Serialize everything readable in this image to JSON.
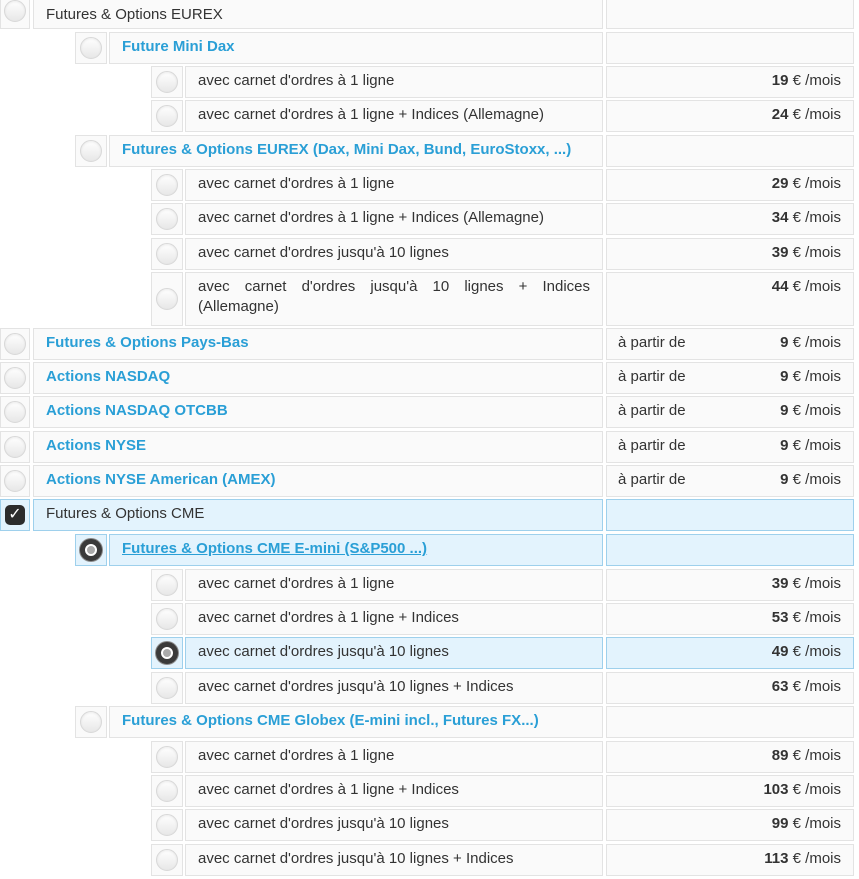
{
  "prefix_from": "à partir de",
  "price_unit": "€ /mois",
  "eurex": {
    "label": "Futures & Options EUREX",
    "mini_dax": {
      "label": "Future Mini Dax",
      "options": [
        {
          "label": "avec carnet d'ordres à 1 ligne",
          "price": "19"
        },
        {
          "label": "avec carnet d'ordres à 1 ligne + Indices (Allemagne)",
          "price": "24"
        }
      ]
    },
    "full": {
      "label": "Futures & Options EUREX (Dax, Mini Dax, Bund, EuroStoxx, ...)",
      "options": [
        {
          "label": "avec carnet d'ordres à 1 ligne",
          "price": "29"
        },
        {
          "label": "avec carnet d'ordres à 1 ligne + Indices (Allemagne)",
          "price": "34"
        },
        {
          "label": "avec carnet d'ordres jusqu'à 10 lignes",
          "price": "39"
        },
        {
          "label": "avec carnet d'ordres jusqu'à 10 lignes + Indices (Allemagne)",
          "price": "44"
        }
      ]
    }
  },
  "markets": [
    {
      "label": "Futures & Options Pays-Bas",
      "price": "9"
    },
    {
      "label": "Actions NASDAQ",
      "price": "9"
    },
    {
      "label": "Actions NASDAQ OTCBB",
      "price": "9"
    },
    {
      "label": "Actions NYSE",
      "price": "9"
    },
    {
      "label": "Actions NYSE American (AMEX)",
      "price": "9"
    }
  ],
  "cme": {
    "label": "Futures & Options CME",
    "checked": true,
    "emini": {
      "label": "Futures & Options CME E-mini (S&P500 ...)",
      "selected": true,
      "options": [
        {
          "label": "avec carnet d'ordres à 1 ligne",
          "price": "39"
        },
        {
          "label": "avec carnet d'ordres à 1 ligne + Indices",
          "price": "53"
        },
        {
          "label": "avec carnet d'ordres jusqu'à 10 lignes",
          "price": "49",
          "selected": true
        },
        {
          "label": "avec carnet d'ordres jusqu'à 10 lignes + Indices",
          "price": "63"
        }
      ]
    },
    "globex": {
      "label": "Futures & Options CME Globex (E-mini incl., Futures FX...)",
      "options": [
        {
          "label": "avec carnet d'ordres à 1 ligne",
          "price": "89"
        },
        {
          "label": "avec carnet d'ordres à 1 ligne + Indices",
          "price": "103"
        },
        {
          "label": "avec carnet d'ordres jusqu'à 10 lignes",
          "price": "99"
        },
        {
          "label": "avec carnet d'ordres jusqu'à 10 lignes + Indices",
          "price": "113"
        }
      ]
    }
  },
  "colors": {
    "link": "#2a9fd6",
    "selected_bg": "#e3f3fd",
    "selected_border": "#9ed0ec"
  }
}
